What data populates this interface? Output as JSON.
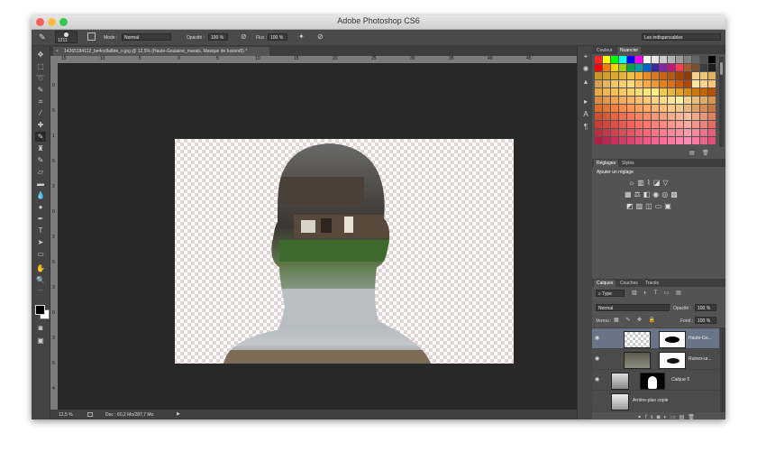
{
  "window": {
    "title": "Adobe Photoshop CS6",
    "workspace": "Les indispensables"
  },
  "options_bar": {
    "brush_size": "1211",
    "mode_label": "Mode :",
    "mode_value": "Normal",
    "opacity_label": "Opacité :",
    "opacity_value": "100 %",
    "flow_label": "Flux :",
    "flow_value": "100 %"
  },
  "document": {
    "tab_title": "14265184112_be4cc8a8de_o.jpg @ 12,5% (Haute-Goulaine_marais, Masque de fusion/8) *",
    "ruler_h": [
      "15",
      "10",
      "5",
      "0",
      "5",
      "10",
      "15",
      "20",
      "25",
      "30",
      "35",
      "40",
      "45"
    ],
    "ruler_v": [
      "0",
      "5",
      "1",
      "5",
      "2",
      "0",
      "2",
      "5",
      "3",
      "0",
      "3",
      "5",
      "4"
    ],
    "zoom": "12,5 %",
    "doc_info": "Doc : 60,2 Mo/287,7 Mo"
  },
  "swatches_panel": {
    "tabs": [
      "Couleur",
      "Nuancier"
    ],
    "colors": [
      [
        "#ff2828",
        "#ffff00",
        "#00ff00",
        "#00ffff",
        "#0000ff",
        "#ff00ff",
        "#ffffff",
        "#e6e6e6",
        "#cccccc",
        "#b3b3b3",
        "#999999",
        "#808080",
        "#666666",
        "#4d4d4d",
        "#000000"
      ],
      [
        "#ff0000",
        "#ff7a00",
        "#ffd200",
        "#a0d200",
        "#00a050",
        "#00a0a0",
        "#0064c8",
        "#3c28a0",
        "#8228a0",
        "#c81478",
        "#ff3c50",
        "#aa5a28",
        "#785032",
        "#3c3c3c",
        "#1e1e1e"
      ],
      [
        "#c89628",
        "#d2a028",
        "#dcaa32",
        "#e6b43c",
        "#f0be46",
        "#faaf32",
        "#e68c28",
        "#dc781e",
        "#c86414",
        "#b45a14",
        "#a0460a",
        "#8c3c0a",
        "#f5d28c",
        "#ebc878",
        "#e1b464"
      ],
      [
        "#d7a050",
        "#e6b45a",
        "#f0c864",
        "#facf6e",
        "#ffd778",
        "#fabe5a",
        "#f5aa46",
        "#f09632",
        "#e6821e",
        "#dc6e14",
        "#c85a0a",
        "#b44600",
        "#ffe6a0",
        "#ffd28c",
        "#fac878"
      ],
      [
        "#e6aa46",
        "#f0b450",
        "#fabe5a",
        "#ffc864",
        "#ffd26e",
        "#ffdc78",
        "#ffe682",
        "#fff08c",
        "#f5c85a",
        "#ebb446",
        "#e1a032",
        "#d78c1e",
        "#cd780a",
        "#c36400",
        "#b95000"
      ],
      [
        "#dc8c3c",
        "#e69646",
        "#f0a050",
        "#faaa5a",
        "#ffb464",
        "#ffbe6e",
        "#ffc878",
        "#ffd282",
        "#ffdc8c",
        "#ffe696",
        "#fff0a0",
        "#f5d28c",
        "#ebbe78",
        "#e1aa64",
        "#d79650"
      ],
      [
        "#dc6e2d",
        "#e67837",
        "#f08241",
        "#fa8c4b",
        "#ff9655",
        "#ffa05f",
        "#ffaa69",
        "#ffb473",
        "#ffbe7d",
        "#ffc887",
        "#f0c891",
        "#e6b47d",
        "#dca069",
        "#d28c55",
        "#c87841"
      ],
      [
        "#d2502d",
        "#dc5a37",
        "#e66441",
        "#f06e4b",
        "#fa7855",
        "#ff825f",
        "#ff8c69",
        "#ff9673",
        "#ffa07d",
        "#ffaa87",
        "#ffb491",
        "#ffbe9b",
        "#f5aa87",
        "#eb9673",
        "#e1825f"
      ],
      [
        "#c83c32",
        "#d2463c",
        "#dc5046",
        "#e65a50",
        "#f0645a",
        "#fa6e64",
        "#ff786e",
        "#ff8278",
        "#ff8c82",
        "#ff968c",
        "#ffa096",
        "#ffaaa0",
        "#f5968c",
        "#eb8278",
        "#e16e64"
      ],
      [
        "#be2d3c",
        "#c83746",
        "#d24150",
        "#dc4b5a",
        "#e65564",
        "#f05f6e",
        "#fa6978",
        "#ff7382",
        "#ff7d8c",
        "#ff8796",
        "#ff91a0",
        "#ff9baa",
        "#f587a0",
        "#eb738c",
        "#e15f78"
      ],
      [
        "#b41e46",
        "#be2850",
        "#c8325a",
        "#d23c64",
        "#dc466e",
        "#e65078",
        "#f05a82",
        "#fa648c",
        "#ff6e96",
        "#ff78a0",
        "#ff82aa",
        "#ff8cb4",
        "#f578a0",
        "#eb648c",
        "#e15078"
      ]
    ]
  },
  "adjustments_panel": {
    "tabs": [
      "Réglages",
      "Styles"
    ],
    "heading": "Ajouter un réglage"
  },
  "layers_panel": {
    "tabs": [
      "Calques",
      "Couches",
      "Tracés"
    ],
    "filter": "Type",
    "blend_mode": "Normal",
    "opacity_label": "Opacité :",
    "opacity_value": "100 %",
    "lock_label": "Verrou :",
    "fill_label": "Fond :",
    "fill_value": "100 %",
    "layers": [
      {
        "name": "Haute-Go...",
        "selected": true
      },
      {
        "name": "Ruines-ur...",
        "selected": false
      },
      {
        "name": "Calque 5",
        "selected": false
      },
      {
        "name": "Arrière-plan copie",
        "selected": false
      }
    ]
  }
}
